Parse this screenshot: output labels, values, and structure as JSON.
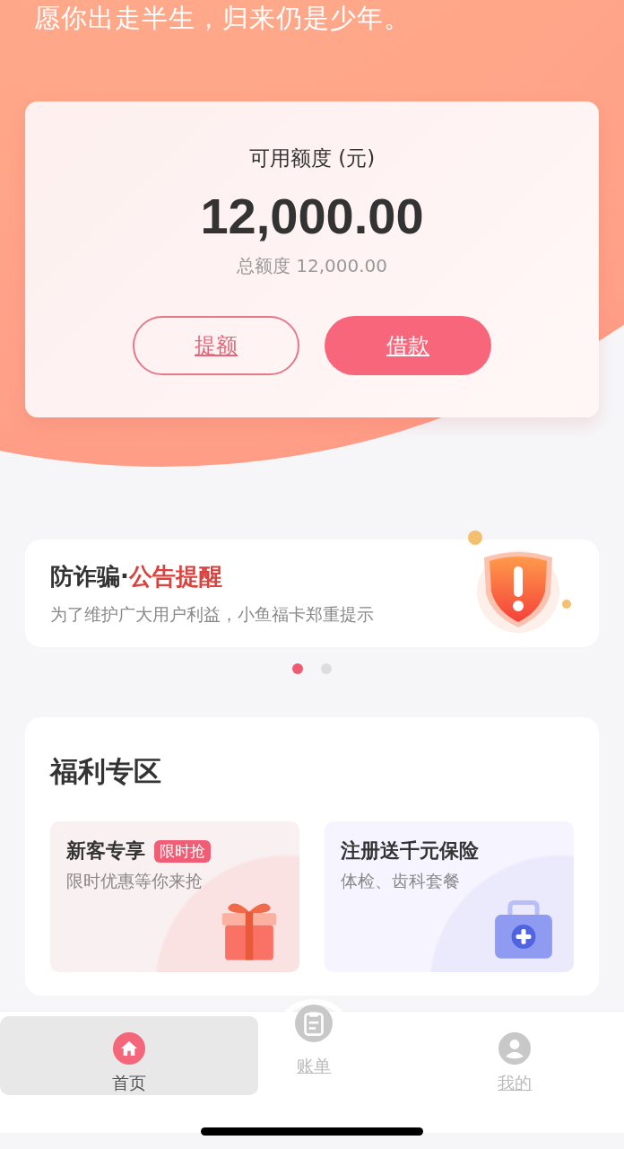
{
  "motto": "愿你出走半生，归来仍是少年。",
  "credit": {
    "label": "可用额度 (元)",
    "amount": "12,000.00",
    "total": "总额度 12,000.00",
    "buttons": [
      {
        "label": "提额",
        "kind": "outline"
      },
      {
        "label": "借款",
        "kind": "filled"
      }
    ]
  },
  "notice": {
    "title": "防诈骗·",
    "highlight": "公告提醒",
    "text": "为了维护广大用户利益，小鱼福卡郑重提示"
  },
  "dots": [
    {
      "selected": true
    },
    {
      "selected": false
    }
  ],
  "welfare": {
    "title": "福利专区",
    "cards": [
      {
        "title": "新客专享",
        "tag": "限时抢",
        "subtitle": "限时优惠等你来抢",
        "kind": "gift"
      },
      {
        "title": "注册送千元保险",
        "subtitle": "体检、齿科套餐",
        "kind": "medkit"
      }
    ]
  },
  "tabs": [
    {
      "label": "首页",
      "selected": true,
      "kind": "home"
    },
    {
      "label": "账单",
      "selected": false,
      "kind": "bill"
    },
    {
      "label": "我的",
      "selected": false,
      "kind": "user"
    }
  ]
}
